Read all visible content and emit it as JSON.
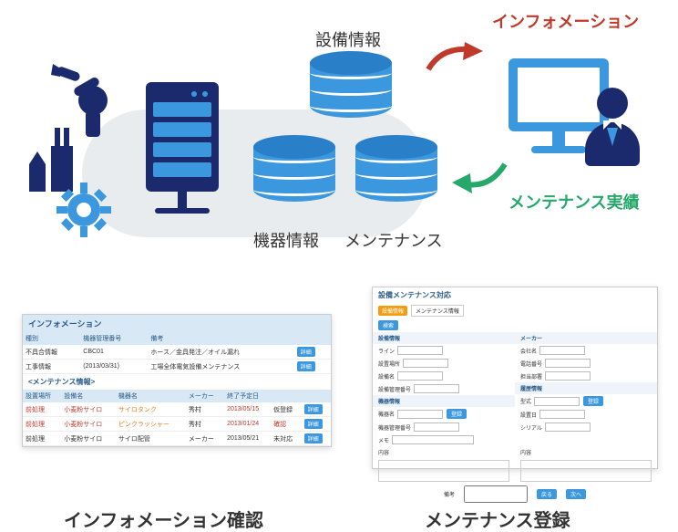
{
  "labels": {
    "equipment_info": "設備情報",
    "device_info": "機器情報",
    "maintenance": "メンテナンス",
    "information": "インフォメーション",
    "maintenance_record": "メンテナンス実績"
  },
  "captions": {
    "left": "インフォメーション確認",
    "right": "メンテナンス登録"
  },
  "panel_info": {
    "title": "インフォメーション",
    "alerts": {
      "header": [
        "種別",
        "機器管理番号",
        "備考",
        ""
      ],
      "rows": [
        {
          "type": "不具合情報",
          "code": "CBC01",
          "note": "ホース／金具発注／オイル漏れ",
          "action": "詳細"
        },
        {
          "type": "工事情報",
          "code": "(2013/03/31)",
          "note": "工場全体電気設備メンテナンス",
          "action": "詳細"
        }
      ]
    },
    "maint": {
      "title": "<メンテナンス情報>",
      "header": [
        "設置場所",
        "設備名",
        "機器名",
        "メーカー",
        "終了予定日",
        "",
        ""
      ],
      "rows": [
        {
          "place": "前処理",
          "equip": "小麦粉サイロ",
          "device": "サイロタンク",
          "maker": "秀村",
          "due": "2013/05/15",
          "status": "仮登録",
          "action": "詳細"
        },
        {
          "place": "前処理",
          "equip": "小麦粉サイロ",
          "device": "ピンクラッシャー",
          "maker": "秀村",
          "due": "2013/01/24",
          "status": "確認",
          "action": "詳細"
        },
        {
          "place": "前処理",
          "equip": "小麦粉サイロ",
          "device": "サイロ配管",
          "maker": "メーカー",
          "due": "2013/05/21",
          "status": "未対応",
          "action": "詳細"
        }
      ]
    }
  },
  "panel_reg": {
    "title": "設備メンテナンス対応",
    "tabs": [
      "設備情報",
      "メンテナンス情報"
    ],
    "search_btn": "検索",
    "register_btn": "登録",
    "sections": {
      "equipment": "設備情報",
      "maker": "メーカー",
      "device": "機器情報",
      "history": "履歴情報",
      "note": "備考"
    },
    "fields": {
      "line": "ライン",
      "place": "設置場所",
      "equip_name": "設備名",
      "equip_code": "設備管理番号",
      "maker_name": "会社名",
      "maker_phone": "電話番号",
      "maker_dept": "担当部署",
      "device_name": "機器名",
      "device_code": "機器管理番号",
      "model": "型式",
      "install_date": "設置日",
      "serial": "シリアル",
      "memo": "メモ",
      "content": "内容",
      "prev": "戻る",
      "next": "次へ"
    }
  }
}
